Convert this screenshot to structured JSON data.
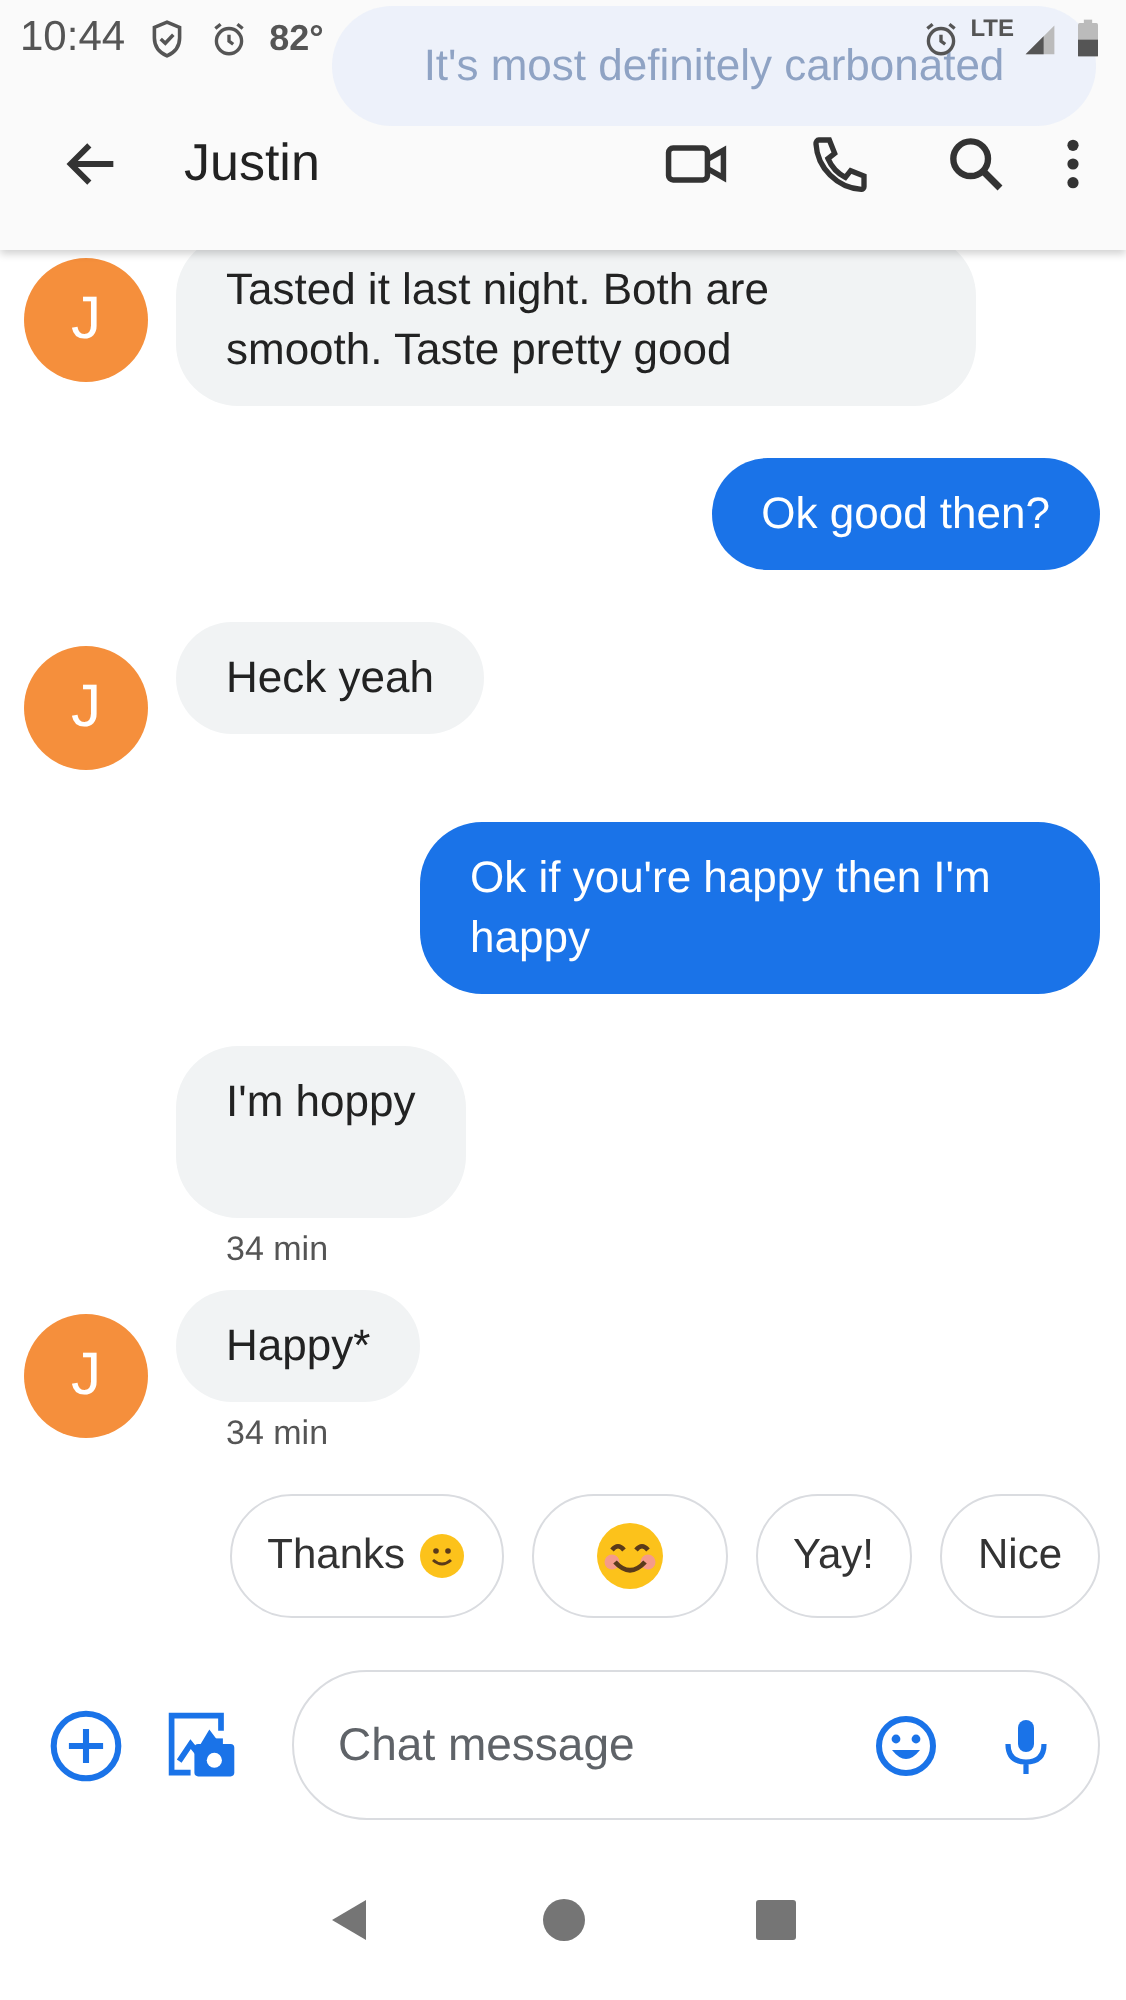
{
  "status_bar": {
    "time": "10:44",
    "temperature": "82°",
    "network": "LTE"
  },
  "ghost_notification": {
    "text": "It's most definitely carbonated"
  },
  "toolbar": {
    "contact": "Justin"
  },
  "messages": [
    {
      "kind": "received",
      "avatar": "J",
      "text": "Tasted it last night. Both are smooth. Taste pretty good",
      "tall": false
    },
    {
      "kind": "sent",
      "text": "Ok good then?",
      "tall": false
    },
    {
      "kind": "received",
      "avatar": "J",
      "text": "Heck yeah",
      "tall": false
    },
    {
      "kind": "sent",
      "text": "Ok if you're happy then I'm happy",
      "tall": false
    },
    {
      "kind": "received",
      "text": "I'm hoppy",
      "tall": true,
      "time": "34 min"
    },
    {
      "kind": "received",
      "avatar": "J",
      "text": "Happy*",
      "tall": false,
      "time": "34 min"
    }
  ],
  "suggestions": [
    {
      "kind": "text_emoji",
      "label": "Thanks"
    },
    {
      "kind": "emoji"
    },
    {
      "kind": "text",
      "label": "Yay!"
    },
    {
      "kind": "text",
      "label": "Nice"
    }
  ],
  "composer": {
    "placeholder": "Chat message"
  }
}
